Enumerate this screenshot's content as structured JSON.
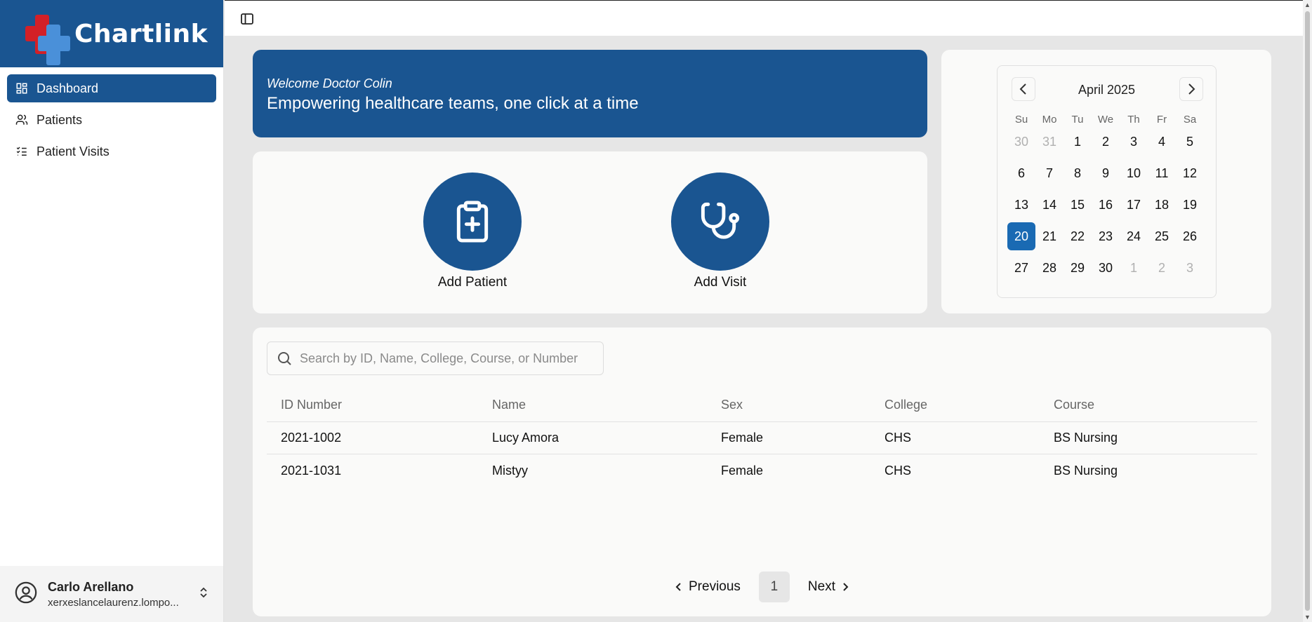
{
  "brand": {
    "name": "Chartlink"
  },
  "sidebar": {
    "items": [
      {
        "label": "Dashboard",
        "icon": "dashboard-icon",
        "active": true
      },
      {
        "label": "Patients",
        "icon": "users-icon",
        "active": false
      },
      {
        "label": "Patient Visits",
        "icon": "list-check-icon",
        "active": false
      }
    ]
  },
  "user": {
    "name": "Carlo Arellano",
    "email": "xerxeslancelaurenz.lompo..."
  },
  "welcome": {
    "subtitle": "Welcome Doctor Colin",
    "title": "Empowering healthcare teams, one click at a time"
  },
  "actions": {
    "add_patient": "Add Patient",
    "add_visit": "Add Visit"
  },
  "calendar": {
    "title": "April 2025",
    "weekdays": [
      "Su",
      "Mo",
      "Tu",
      "We",
      "Th",
      "Fr",
      "Sa"
    ],
    "weeks": [
      [
        {
          "d": "30",
          "m": true
        },
        {
          "d": "31",
          "m": true
        },
        {
          "d": "1"
        },
        {
          "d": "2"
        },
        {
          "d": "3"
        },
        {
          "d": "4"
        },
        {
          "d": "5"
        }
      ],
      [
        {
          "d": "6"
        },
        {
          "d": "7"
        },
        {
          "d": "8"
        },
        {
          "d": "9"
        },
        {
          "d": "10"
        },
        {
          "d": "11"
        },
        {
          "d": "12"
        }
      ],
      [
        {
          "d": "13"
        },
        {
          "d": "14"
        },
        {
          "d": "15"
        },
        {
          "d": "16"
        },
        {
          "d": "17"
        },
        {
          "d": "18"
        },
        {
          "d": "19"
        }
      ],
      [
        {
          "d": "20",
          "s": true
        },
        {
          "d": "21"
        },
        {
          "d": "22"
        },
        {
          "d": "23"
        },
        {
          "d": "24"
        },
        {
          "d": "25"
        },
        {
          "d": "26"
        }
      ],
      [
        {
          "d": "27"
        },
        {
          "d": "28"
        },
        {
          "d": "29"
        },
        {
          "d": "30"
        },
        {
          "d": "1",
          "m": true
        },
        {
          "d": "2",
          "m": true
        },
        {
          "d": "3",
          "m": true
        }
      ]
    ]
  },
  "search": {
    "placeholder": "Search by ID, Name, College, Course, or Number",
    "value": ""
  },
  "table": {
    "headers": [
      "ID Number",
      "Name",
      "Sex",
      "College",
      "Course"
    ],
    "rows": [
      [
        "2021-1002",
        "Lucy Amora",
        "Female",
        "CHS",
        "BS Nursing"
      ],
      [
        "2021-1031",
        "Mistyy",
        "Female",
        "CHS",
        "BS Nursing"
      ]
    ]
  },
  "pagination": {
    "previous": "Previous",
    "next": "Next",
    "current": "1"
  },
  "colors": {
    "primary": "#1a5591",
    "selected_day": "#1a6ab3",
    "logo_red": "#d32027",
    "logo_blue": "#4a90d9"
  }
}
